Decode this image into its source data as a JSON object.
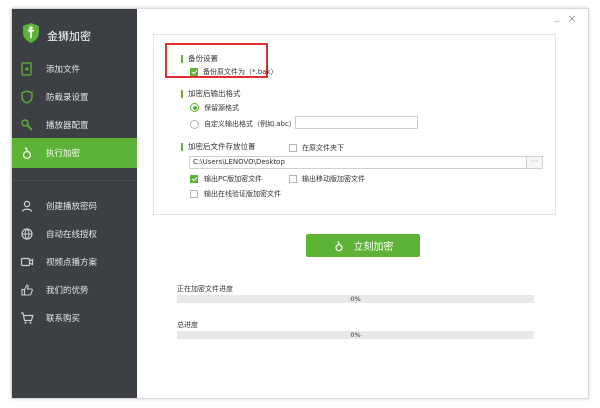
{
  "app": {
    "title": "金狮加密"
  },
  "sidebar": {
    "items": [
      {
        "label": "添加文件",
        "icon": "add-file-icon"
      },
      {
        "label": "防截录设置",
        "icon": "shield-icon"
      },
      {
        "label": "播放器配置",
        "icon": "wrench-icon"
      },
      {
        "label": "执行加密",
        "icon": "encrypt-icon",
        "active": true
      },
      {
        "label": "创建播放密码",
        "icon": "user-icon"
      },
      {
        "label": "自动在线授权",
        "icon": "globe-icon"
      },
      {
        "label": "视频点播方案",
        "icon": "video-icon"
      },
      {
        "label": "我们的优势",
        "icon": "thumbs-up-icon"
      },
      {
        "label": "联系购买",
        "icon": "cart-icon"
      }
    ]
  },
  "window": {
    "minimize": "_",
    "close": "×"
  },
  "backup": {
    "title": "备份设置",
    "backup_label": "备份原文件为（*.bak）",
    "backup_checked": true
  },
  "output_format": {
    "title": "加密后输出格式",
    "keep_label": "保留源格式",
    "custom_label": "自定义输出格式（例如.abc）",
    "custom_value": "",
    "selected": "keep"
  },
  "save_location": {
    "title": "加密后文件存放位置",
    "same_folder_label": "在原文件夹下",
    "same_folder_checked": false,
    "path_value": "C:\\Users\\LENOVO\\Desktop",
    "browse_label": "···",
    "pc_label": "输出PC版加密文件",
    "pc_checked": true,
    "mobile_label": "输出移动版加密文件",
    "mobile_checked": false,
    "verify_label": "输出在线验证版加密文件",
    "verify_checked": false
  },
  "encrypt_button": {
    "label": "立刻加密"
  },
  "progress": {
    "current_label": "正在加密文件进度",
    "current_value": 0,
    "current_text": "0%",
    "total_label": "总进度",
    "total_value": 0,
    "total_text": "0%"
  },
  "colors": {
    "accent": "#5db336",
    "sidebar": "#3c3f43",
    "highlight": "#e12d2d"
  }
}
